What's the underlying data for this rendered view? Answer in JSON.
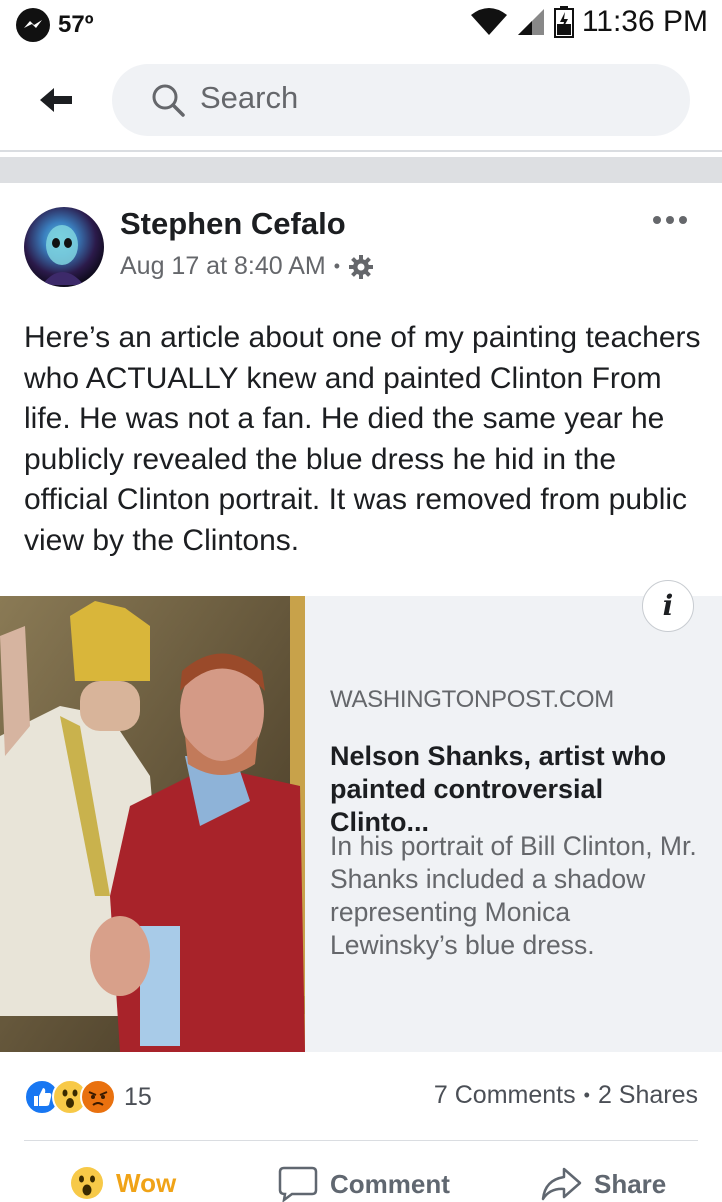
{
  "status_bar": {
    "temperature": "57º",
    "time": "11:36 PM"
  },
  "search": {
    "placeholder": "Search"
  },
  "post": {
    "author": "Stephen Cefalo",
    "timestamp": "Aug 17 at 8:40 AM",
    "separator": "•",
    "text": "Here’s an article about one of my painting teachers who ACTUALLY knew and painted Clinton From life.  He was not a fan. He died the same year he publicly revealed the blue dress he hid in the official Clinton portrait. It was removed from public view by the Clintons."
  },
  "link_card": {
    "info_glyph": "i",
    "domain": "WASHINGTONPOST.COM",
    "headline": "Nelson Shanks, artist who painted controversial Clinto...",
    "description": "In his portrait of Bill Clinton, Mr. Shanks included a shadow representing Monica Lewinsky’s blue dress."
  },
  "engagement": {
    "reactions": [
      "like-icon",
      "wow-icon",
      "angry-icon"
    ],
    "reaction_count": "15",
    "comments": "7 Comments",
    "shares": "2 Shares",
    "separator": "•"
  },
  "actions": {
    "wow_label": "Wow",
    "comment_label": "Comment",
    "share_label": "Share"
  },
  "colors": {
    "wow_accent": "#f0a317",
    "like_blue": "#1877f2",
    "angry_red": "#e9710f",
    "secondary_text": "#65676b"
  }
}
